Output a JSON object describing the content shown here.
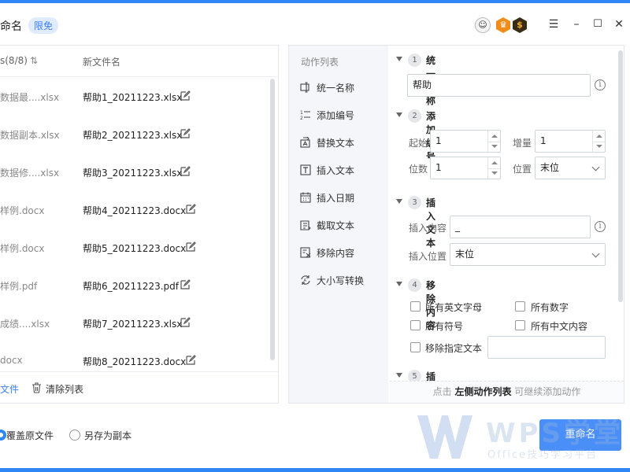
{
  "window": {
    "title": "命名",
    "badge": "限免",
    "avatar_char": "☺",
    "hex1_char": "♛",
    "hex2_char": "$",
    "min": "–",
    "max": "☐",
    "close": "✕",
    "menu": "☰"
  },
  "file_list": {
    "col_original": "s(8/8)",
    "sort_icon": "⇅",
    "col_new": "新文件名",
    "rows": [
      {
        "original": "数据最....xlsx",
        "new": "帮助1_20211223.xlsx"
      },
      {
        "original": "数据副本.xlsx",
        "new": "帮助2_20211223.xlsx"
      },
      {
        "original": "数据修....xlsx",
        "new": "帮助3_20211223.xlsx"
      },
      {
        "original": "样例.docx",
        "new": "帮助4_20211223.docx"
      },
      {
        "original": "样例.docx",
        "new": "帮助5_20211223.docx"
      },
      {
        "original": "样例.pdf",
        "new": "帮助6_20211223.pdf"
      },
      {
        "original": "成绩....xlsx",
        "new": "帮助7_20211223.xlsx"
      },
      {
        "original": "docx",
        "new": "帮助8_20211223.docx"
      }
    ],
    "footer_add": "文件",
    "footer_clear": "清除列表"
  },
  "actions": {
    "title": "动作列表",
    "items": [
      {
        "label": "统一名称",
        "icon": "rename-icon"
      },
      {
        "label": "添加编号",
        "icon": "numbered-list-icon"
      },
      {
        "label": "替换文本",
        "icon": "replace-text-icon"
      },
      {
        "label": "插入文本",
        "icon": "text-insert-icon"
      },
      {
        "label": "插入日期",
        "icon": "calendar-icon"
      },
      {
        "label": "截取文本",
        "icon": "crop-text-icon"
      },
      {
        "label": "移除内容",
        "icon": "remove-content-icon"
      },
      {
        "label": "大小写转换",
        "icon": "case-convert-icon"
      }
    ]
  },
  "config": {
    "s1": {
      "num": "1",
      "title": "统一名称",
      "value": "帮助"
    },
    "s2": {
      "num": "2",
      "title": "添加编号",
      "start_label": "起始",
      "start_value": "1",
      "step_label": "增量",
      "step_value": "1",
      "digits_label": "位数",
      "digits_value": "1",
      "pos_label": "位置",
      "pos_value": "末位"
    },
    "s3": {
      "num": "3",
      "title": "插入文本",
      "content_label": "插入内容",
      "content_value": "_",
      "pos_label": "插入位置",
      "pos_value": "末位"
    },
    "s4": {
      "num": "4",
      "title": "移除内容",
      "opt1": "所有英文字母",
      "opt2": "所有数字",
      "opt3": "所有符号",
      "opt4": "所有中文内容",
      "opt5": "移除指定文本"
    },
    "s5": {
      "num": "5",
      "title": "插入日期"
    },
    "hint_pre": "点击 ",
    "hint_bold": "左侧动作列表",
    "hint_post": " 可继续添加动作"
  },
  "bottom": {
    "overwrite_label": "覆盖原文件",
    "copy_label": "另存为副本",
    "rename_button": "重命名"
  },
  "watermark": {
    "brand": "WPS学堂",
    "sub": "Office技巧学习平台"
  }
}
